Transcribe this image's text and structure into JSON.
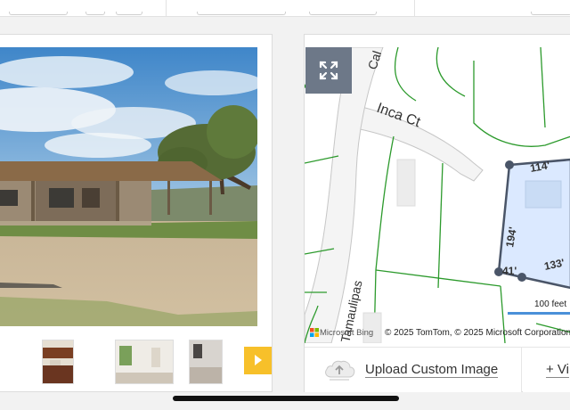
{
  "map": {
    "street_inca": "Inca Ct",
    "street_tamaulipas": "Tamaulipas",
    "street_top": "Cal",
    "dim_top": "114'",
    "dim_left": "194'",
    "dim_bottom_left": "41'",
    "dim_bottom_right": "133'",
    "scale_label": "100 feet",
    "bing_label": "Microsoft Bing",
    "attribution": "© 2025 TomTom, © 2025 Microsoft Corporation, ©"
  },
  "actions": {
    "upload_label": "Upload Custom Image",
    "view_label": "+ Vi"
  },
  "colors": {
    "parcel_line": "#2c9a2c",
    "parcel_fill": "#dbe9ff",
    "parcel_edge": "#4a5568",
    "accent_yellow": "#f7c02a",
    "expand_button": "#6d7888"
  },
  "icons": {
    "expand": "expand-icon",
    "upload": "cloud-upload-icon",
    "play": "play-icon"
  }
}
